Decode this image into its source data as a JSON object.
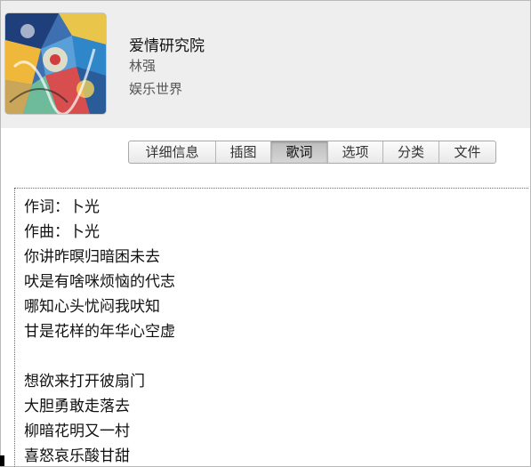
{
  "track": {
    "title": "爱情研究院",
    "artist": "林强",
    "album": "娱乐世界"
  },
  "album_art_icon": "album-art",
  "tabs": [
    {
      "label": "详细信息",
      "active": false
    },
    {
      "label": "插图",
      "active": false
    },
    {
      "label": "歌词",
      "active": true
    },
    {
      "label": "选项",
      "active": false
    },
    {
      "label": "分类",
      "active": false
    },
    {
      "label": "文件",
      "active": false
    }
  ],
  "lyrics": {
    "text": "作词：卜光\n作曲：卜光\n你讲昨暝归暗困未去\n吠是有啥咪烦恼的代志\n哪知心头忧闷我吠知\n甘是花样的年华心空虚\n\n想欲来打开彼扇门\n大胆勇敢走落去\n柳暗花明又一村\n喜怒哀乐酸甘甜"
  },
  "colors": {
    "header_bg": "#eeeeee",
    "active_tab_bg": "#c4c4c4"
  }
}
